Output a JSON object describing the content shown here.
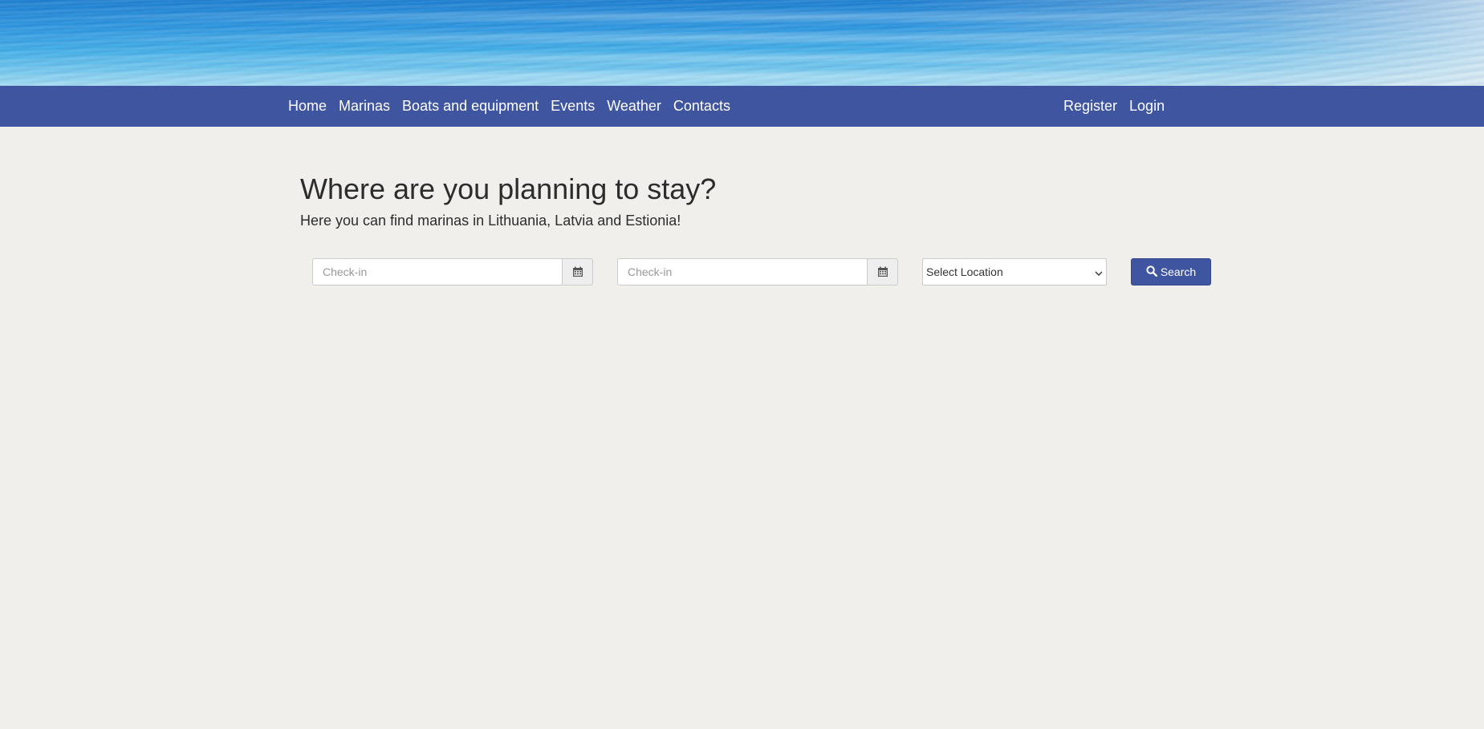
{
  "banner": {
    "image": "sea-water-photo",
    "colors": [
      "#1d7fd0",
      "#44b0e7",
      "#a6dcf2"
    ]
  },
  "navbar": {
    "background": "#3f55a0",
    "left_items": [
      {
        "label": "Home"
      },
      {
        "label": "Marinas"
      },
      {
        "label": "Boats and equipment"
      },
      {
        "label": "Events"
      },
      {
        "label": "Weather"
      },
      {
        "label": "Contacts"
      }
    ],
    "right_items": [
      {
        "label": "Register"
      },
      {
        "label": "Login"
      }
    ]
  },
  "main": {
    "title": "Where are you planning to stay?",
    "subtitle": "Here you can find marinas in Lithuania, Latvia and Estionia!",
    "search_form": {
      "checkin_1": {
        "value": "",
        "placeholder": "Check-in",
        "icon": "calendar-icon"
      },
      "checkin_2": {
        "value": "",
        "placeholder": "Check-in",
        "icon": "calendar-icon"
      },
      "location": {
        "selected": "Select Location",
        "icon": "chevron-down-icon"
      },
      "search_button": {
        "label": "Search",
        "icon": "search-icon"
      }
    }
  }
}
